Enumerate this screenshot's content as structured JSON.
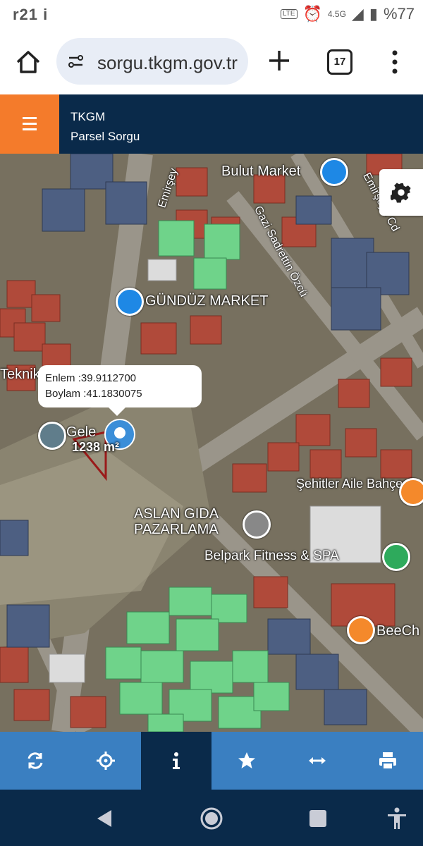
{
  "status_bar": {
    "time": "r21 i",
    "network": "4.5G",
    "lte": "LTE",
    "battery": "%77"
  },
  "browser": {
    "url": "sorgu.tkgm.gov.tr",
    "tab_count": "17"
  },
  "app": {
    "title": "TKGM",
    "subtitle": "Parsel Sorgu"
  },
  "map": {
    "labels": {
      "bulut_market": "Bulut Market",
      "gunduz_market": "GÜNDÜZ MARKET",
      "street_emirsey": "Emirşey",
      "street_gazi": "Gazi Sadrettin Özcü",
      "street_right": "Emirşeyh Cd",
      "aile_bahcesi": "Şehitler Aile Bahçesi",
      "aslan_gida": "ASLAN GIDA PAZARLAMA",
      "fitness": "Belpark Fitness & SPA",
      "beech": "BeeCh",
      "teknik": "Teknik",
      "gele": "Gele"
    },
    "popup": {
      "lat_label": "Enlem",
      "lat_value": ":39.9112700",
      "lon_label": "Boylam",
      "lon_value": ":41.1830075"
    },
    "measurement": "1238 m²"
  },
  "toolbar": {
    "tools": [
      {
        "name": "refresh-icon",
        "active": false
      },
      {
        "name": "locate-icon",
        "active": false
      },
      {
        "name": "info-icon",
        "active": true
      },
      {
        "name": "star-icon",
        "active": false
      },
      {
        "name": "measure-icon",
        "active": false
      },
      {
        "name": "print-icon",
        "active": false
      }
    ]
  },
  "colors": {
    "header_bg": "#0a2a4a",
    "menu_bg": "#f47b2b",
    "toolbar_bg": "#3a7fc1",
    "marker": "#3b8ed8"
  }
}
